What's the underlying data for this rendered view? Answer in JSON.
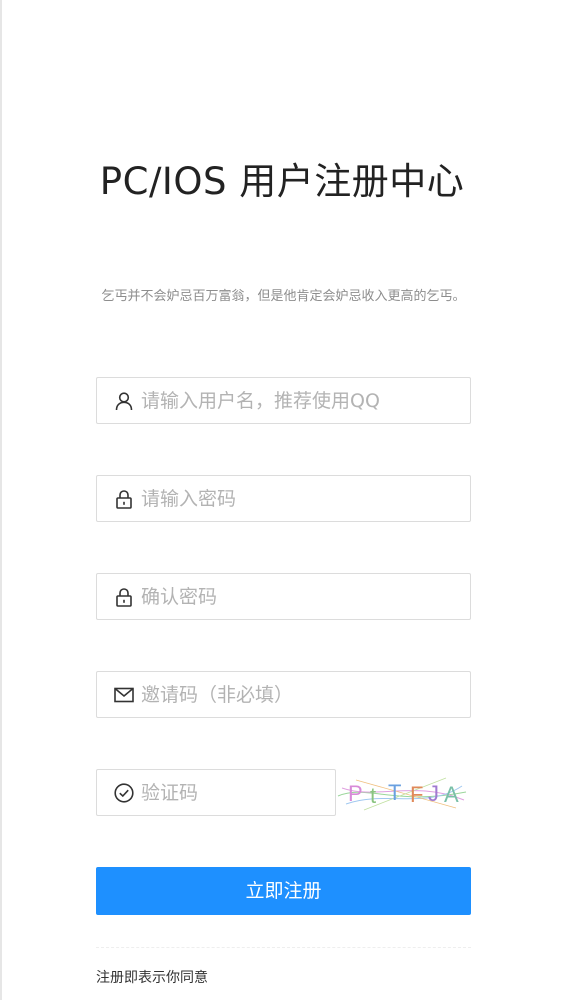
{
  "page": {
    "title": "PC/IOS 用户注册中心",
    "subtitle": "乞丐并不会妒忌百万富翁，但是他肯定会妒忌收入更高的乞丐。"
  },
  "form": {
    "username": {
      "placeholder": "请输入用户名，推荐使用QQ",
      "value": "",
      "icon": "user-icon"
    },
    "password": {
      "placeholder": "请输入密码",
      "value": "",
      "icon": "lock-icon"
    },
    "confirm_password": {
      "placeholder": "确认密码",
      "value": "",
      "icon": "lock-icon"
    },
    "invite_code": {
      "placeholder": "邀请码（非必填）",
      "value": "",
      "icon": "mail-icon"
    },
    "captcha": {
      "placeholder": "验证码",
      "value": "",
      "icon": "check-circle-icon",
      "image_text": "PtTFJA"
    },
    "submit_label": "立即注册",
    "agreement_text": "注册即表示你同意"
  },
  "colors": {
    "primary": "#1e90ff",
    "border": "#dcdcdc",
    "placeholder": "#b3b3b3",
    "subtitle": "#8d8d8d"
  }
}
